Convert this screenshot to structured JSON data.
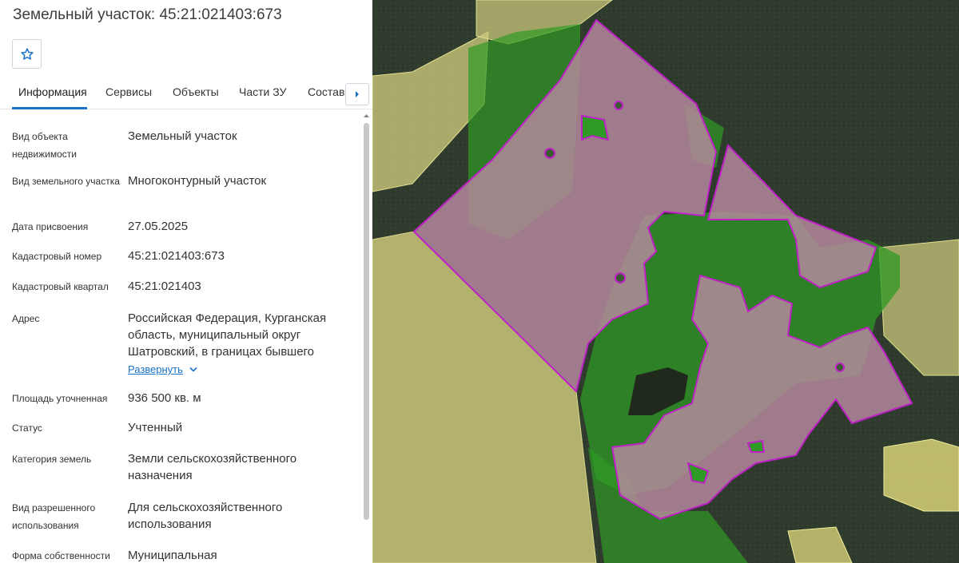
{
  "header": {
    "title": "Земельный участок: 45:21:021403:673"
  },
  "favorite": {
    "icon": "star-outline-icon"
  },
  "tabs": [
    {
      "label": "Информация",
      "active": true
    },
    {
      "label": "Сервисы",
      "active": false
    },
    {
      "label": "Объекты",
      "active": false
    },
    {
      "label": "Части ЗУ",
      "active": false
    },
    {
      "label": "Состав",
      "active": false
    }
  ],
  "tab_scroll_icon": "caret-right-icon",
  "info": {
    "object_type": {
      "label": "Вид объекта недвижимости",
      "value": "Земельный участок"
    },
    "land_type": {
      "label": "Вид земельного участка",
      "value": "Многоконтурный участок"
    },
    "assign_date": {
      "label": "Дата присвоения",
      "value": "27.05.2025"
    },
    "cadastral_number": {
      "label": "Кадастровый номер",
      "value": "45:21:021403:673"
    },
    "cadastral_quarter": {
      "label": "Кадастровый квартал",
      "value": "45:21:021403"
    },
    "address": {
      "label": "Адрес",
      "value": "Российская Федерация, Курганская область, муниципальный округ Шатровский, в границах бывшего",
      "expand_label": "Развернуть"
    },
    "area": {
      "label": "Площадь уточненная",
      "value": "936 500 кв. м"
    },
    "status": {
      "label": "Статус",
      "value": "Учтенный"
    },
    "land_category": {
      "label": "Категория земель",
      "value": "Земли сельскохозяйственного назначения"
    },
    "permitted_use": {
      "label": "Вид разрешенного использования",
      "value": "Для сельскохозяйственного использования"
    },
    "ownership": {
      "label": "Форма собственности",
      "value": "Муниципальная"
    }
  },
  "colors": {
    "accent": "#1a73c8",
    "parcel_fill": "#b88aa0",
    "parcel_border": "#c020c8",
    "forest_fill": "#2f9a24",
    "field_fill": "#c9c77a"
  }
}
